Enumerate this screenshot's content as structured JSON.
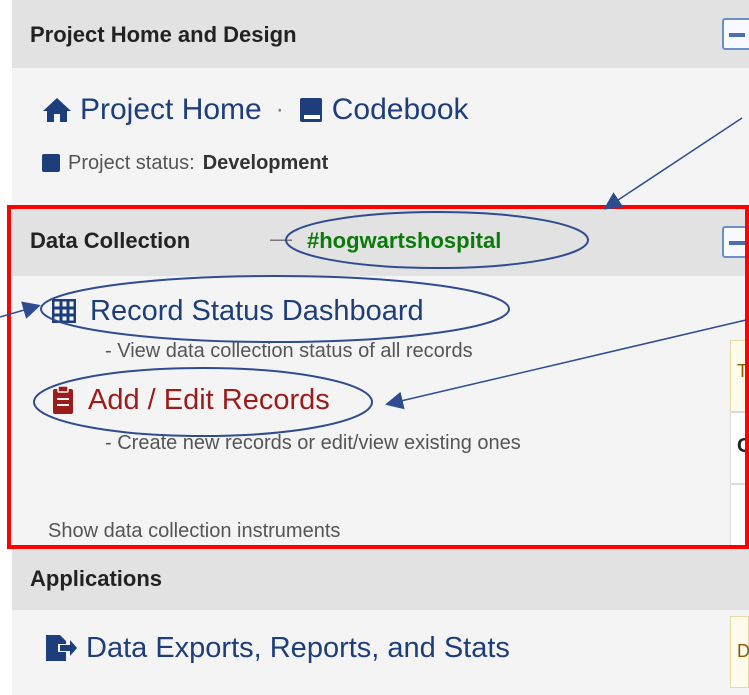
{
  "sections": {
    "design": {
      "title": "Project Home and Design",
      "project_home": "Project Home",
      "separator": "·",
      "codebook": "Codebook",
      "status_label": "Project status:",
      "status_value": "Development"
    },
    "data_collection": {
      "title": "Data Collection",
      "dash": "—",
      "tag": "#hogwartshospital",
      "record_status": "Record Status Dashboard",
      "record_status_desc": "- View data collection status of all records",
      "add_edit": "Add / Edit Records",
      "add_edit_desc": "- Create new records or edit/view existing ones",
      "show_instruments": "Show data collection instruments"
    },
    "applications": {
      "title": "Applications",
      "exports": "Data Exports, Reports, and Stats"
    }
  },
  "right_panel": {
    "letters": [
      "T",
      "C",
      "D"
    ]
  },
  "colors": {
    "highlight_box": "#ff0000",
    "annotation": "#2e4c8f",
    "tag_green": "#0a7a0a"
  }
}
